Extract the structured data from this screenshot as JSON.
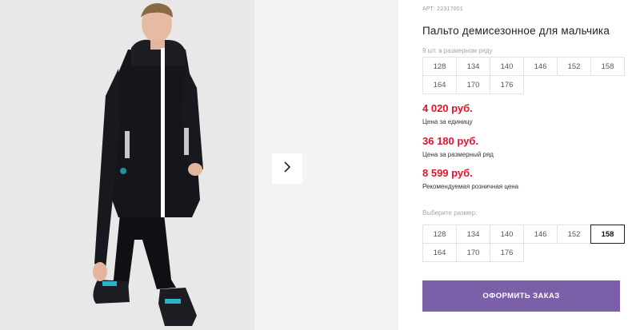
{
  "gallery": {
    "next_icon": "chevron-right-icon"
  },
  "product": {
    "article_label": "АРТ: 22317001",
    "title": "Пальто демисезонное для мальчика",
    "pack_note": "9 шт. в размерном ряду",
    "pack_sizes": [
      "128",
      "134",
      "140",
      "146",
      "152",
      "158",
      "164",
      "170",
      "176"
    ]
  },
  "prices": {
    "unit_price": "4 020 руб.",
    "unit_label": "Цена за единицу",
    "row_price": "36 180 руб.",
    "row_label": "Цена за размерный ряд",
    "retail_price": "8 599 руб.",
    "retail_label": "Рекомендуемая розничная цена",
    "price_color": "#e0142c"
  },
  "size_select": {
    "label": "Выберите размер:",
    "sizes": [
      "128",
      "134",
      "140",
      "146",
      "152",
      "158",
      "164",
      "170",
      "176"
    ],
    "selected": "158"
  },
  "order_button": {
    "label": "ОФОРМИТЬ ЗАКАЗ",
    "color": "#7b5fa8"
  }
}
